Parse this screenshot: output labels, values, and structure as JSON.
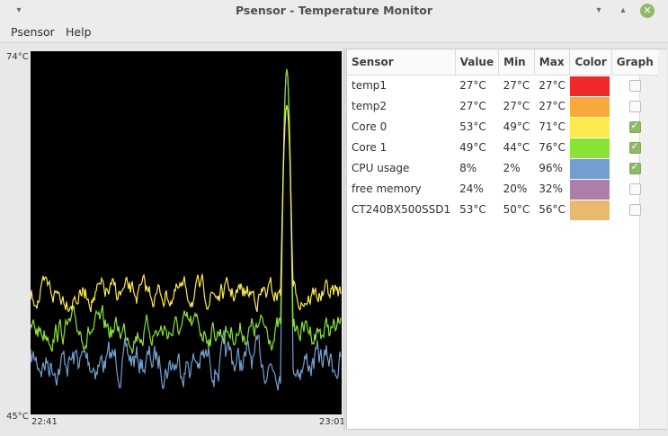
{
  "window": {
    "title": "Psensor - Temperature Monitor"
  },
  "menu": {
    "items": [
      "Psensor",
      "Help"
    ]
  },
  "graph": {
    "y_max_label": "74°C",
    "y_min_label": "45°C",
    "x_start_label": "22:41",
    "x_end_label": "23:01"
  },
  "table": {
    "headers": {
      "sensor": "Sensor",
      "value": "Value",
      "min": "Min",
      "max": "Max",
      "color": "Color",
      "graph": "Graph"
    },
    "rows": [
      {
        "sensor": "temp1",
        "value": "27°C",
        "min": "27°C",
        "max": "27°C",
        "color": "#ef2a2a",
        "graph": false
      },
      {
        "sensor": "temp2",
        "value": "27°C",
        "min": "27°C",
        "max": "27°C",
        "color": "#f9a93c",
        "graph": false
      },
      {
        "sensor": "Core 0",
        "value": "53°C",
        "min": "49°C",
        "max": "71°C",
        "color": "#fce94f",
        "graph": true
      },
      {
        "sensor": "Core 1",
        "value": "49°C",
        "min": "44°C",
        "max": "76°C",
        "color": "#8ae234",
        "graph": true
      },
      {
        "sensor": "CPU usage",
        "value": "8%",
        "min": "2%",
        "max": "96%",
        "color": "#729fcf",
        "graph": true
      },
      {
        "sensor": "free memory",
        "value": "24%",
        "min": "20%",
        "max": "32%",
        "color": "#ad7fa8",
        "graph": false
      },
      {
        "sensor": "CT240BX500SSD1",
        "value": "53°C",
        "min": "50°C",
        "max": "56°C",
        "color": "#e9b96e",
        "graph": false
      }
    ]
  }
}
